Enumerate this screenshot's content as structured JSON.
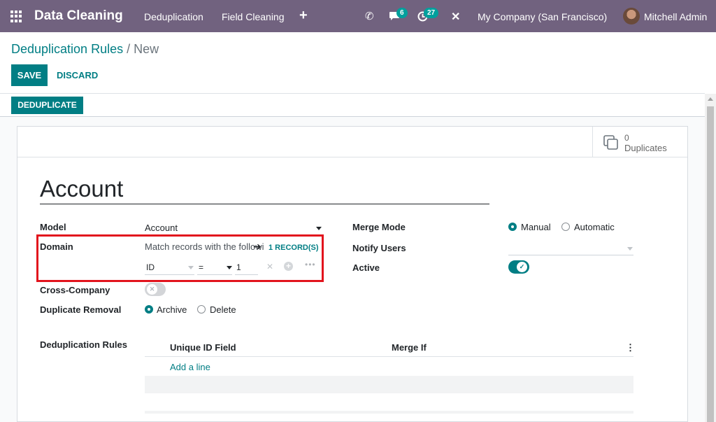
{
  "navbar": {
    "app_name": "Data Cleaning",
    "menu": [
      "Deduplication",
      "Field Cleaning"
    ],
    "plus": "+",
    "phone_icon": "✆",
    "chat_count": "6",
    "activity_count": "27",
    "debug_icon": "✕",
    "company": "My Company (San Francisco)",
    "user": "Mitchell Admin"
  },
  "breadcrumb": {
    "parent": "Deduplication Rules",
    "separator": "/",
    "current": "New"
  },
  "buttons": {
    "save": "SAVE",
    "discard": "DISCARD",
    "deduplicate": "DEDUPLICATE"
  },
  "stat": {
    "count": "0",
    "label": "Duplicates"
  },
  "form": {
    "name": "Account",
    "model_label": "Model",
    "model_value": "Account",
    "domain_label": "Domain",
    "domain_text": "Match records with the following rule:",
    "domain_records": "1 RECORD(S)",
    "domain_field": "ID",
    "domain_operator": "=",
    "domain_value": "1",
    "cross_company_label": "Cross-Company",
    "duplicate_removal_label": "Duplicate Removal",
    "removal_options": [
      "Archive",
      "Delete"
    ],
    "removal_selected": "Archive",
    "merge_mode_label": "Merge Mode",
    "merge_options": [
      "Manual",
      "Automatic"
    ],
    "merge_selected": "Manual",
    "notify_users_label": "Notify Users",
    "active_label": "Active",
    "active": true,
    "rules_label": "Deduplication Rules",
    "rules_columns": [
      "Unique ID Field",
      "Merge If"
    ],
    "add_line": "Add a line"
  }
}
